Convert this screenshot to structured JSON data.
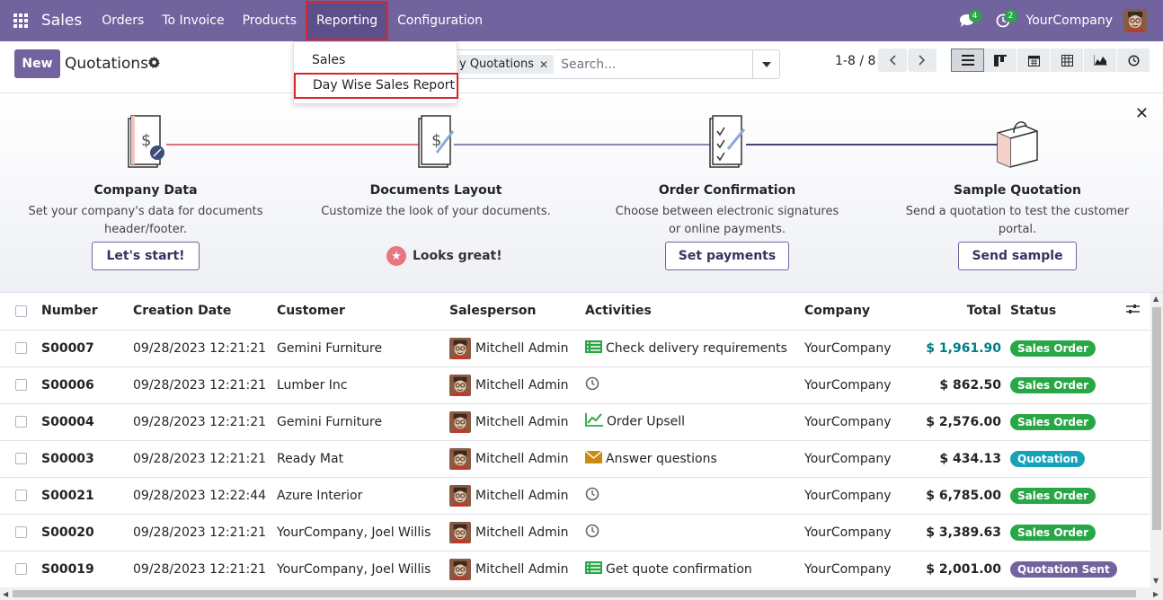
{
  "app": {
    "name": "Sales",
    "menus": [
      "Orders",
      "To Invoice",
      "Products",
      "Reporting",
      "Configuration"
    ],
    "active_menu": "Reporting",
    "messages_count": "4",
    "activities_count": "2",
    "company": "YourCompany"
  },
  "control": {
    "new_label": "New",
    "title": "Quotations",
    "facet_label": "y Quotations",
    "search_placeholder": "Search...",
    "pager": "1-8 / 8"
  },
  "dropdown": {
    "items": [
      "Sales",
      "Day Wise Sales Report"
    ],
    "highlighted": "Day Wise Sales Report"
  },
  "banner": {
    "steps": [
      {
        "title": "Company Data",
        "desc1": "Set your company's data for documents",
        "desc2": "header/footer.",
        "button": "Let's start!"
      },
      {
        "title": "Documents Layout",
        "desc1": "Customize the look of your documents.",
        "desc2": "",
        "button": "Looks great!"
      },
      {
        "title": "Order Confirmation",
        "desc1": "Choose between electronic signatures",
        "desc2": "or online payments.",
        "button": "Set payments"
      },
      {
        "title": "Sample Quotation",
        "desc1": "Send a quotation to test the customer",
        "desc2": "portal.",
        "button": "Send sample"
      }
    ]
  },
  "table": {
    "headers": [
      "Number",
      "Creation Date",
      "Customer",
      "Salesperson",
      "Activities",
      "Company",
      "Total",
      "Status"
    ],
    "rows": [
      {
        "number": "S00007",
        "date": "09/28/2023 12:21:21",
        "customer": "Gemini Furniture",
        "salesperson": "Mitchell Admin",
        "activity": "Check delivery requirements",
        "activity_icon": "list-icon",
        "company": "YourCompany",
        "total": "$ 1,961.90",
        "status": "Sales Order"
      },
      {
        "number": "S00006",
        "date": "09/28/2023 12:21:21",
        "customer": "Lumber Inc",
        "salesperson": "Mitchell Admin",
        "activity": "",
        "activity_icon": "clock-icon",
        "company": "YourCompany",
        "total": "$ 862.50",
        "status": "Sales Order"
      },
      {
        "number": "S00004",
        "date": "09/28/2023 12:21:21",
        "customer": "Gemini Furniture",
        "salesperson": "Mitchell Admin",
        "activity": "Order Upsell",
        "activity_icon": "chart-icon",
        "company": "YourCompany",
        "total": "$ 2,576.00",
        "status": "Sales Order"
      },
      {
        "number": "S00003",
        "date": "09/28/2023 12:21:21",
        "customer": "Ready Mat",
        "salesperson": "Mitchell Admin",
        "activity": "Answer questions",
        "activity_icon": "envelope-icon",
        "company": "YourCompany",
        "total": "$ 434.13",
        "status": "Quotation"
      },
      {
        "number": "S00021",
        "date": "09/28/2023 12:22:44",
        "customer": "Azure Interior",
        "salesperson": "Mitchell Admin",
        "activity": "",
        "activity_icon": "clock-icon",
        "company": "YourCompany",
        "total": "$ 6,785.00",
        "status": "Sales Order"
      },
      {
        "number": "S00020",
        "date": "09/28/2023 12:21:21",
        "customer": "YourCompany, Joel Willis",
        "salesperson": "Mitchell Admin",
        "activity": "",
        "activity_icon": "clock-icon",
        "company": "YourCompany",
        "total": "$ 3,389.63",
        "status": "Sales Order"
      },
      {
        "number": "S00019",
        "date": "09/28/2023 12:21:21",
        "customer": "YourCompany, Joel Willis",
        "salesperson": "Mitchell Admin",
        "activity": "Get quote confirmation",
        "activity_icon": "list-icon",
        "company": "YourCompany",
        "total": "$ 2,001.00",
        "status": "Quotation Sent"
      }
    ]
  },
  "colors": {
    "brand": "#71639e",
    "sales_order": "#28a745",
    "quotation": "#17a2b8",
    "quotation_sent": "#71639e",
    "total_highlight": "#017e84"
  }
}
